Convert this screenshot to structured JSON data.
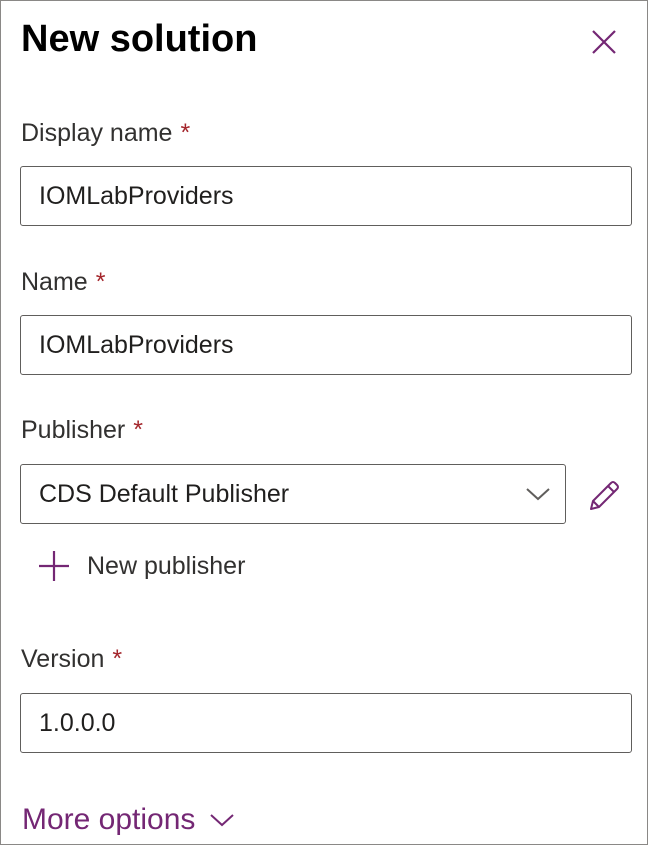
{
  "panel": {
    "title": "New solution"
  },
  "display_name": {
    "label": "Display name",
    "required_mark": "*",
    "value": "IOMLabProviders"
  },
  "name": {
    "label": "Name",
    "required_mark": "*",
    "value": "IOMLabProviders"
  },
  "publisher": {
    "label": "Publisher",
    "required_mark": "*",
    "selected": "CDS Default Publisher",
    "new_publisher_label": "New publisher"
  },
  "version": {
    "label": "Version",
    "required_mark": "*",
    "value": "1.0.0.0"
  },
  "more_options": {
    "label": "More options"
  },
  "icons": {
    "close": "close-icon",
    "dropdown": "chevron-down-icon",
    "edit": "pencil-icon",
    "add": "plus-icon",
    "expand": "chevron-down-icon"
  },
  "colors": {
    "accent": "#742774",
    "required": "#a4262c",
    "border": "#605e5c"
  }
}
